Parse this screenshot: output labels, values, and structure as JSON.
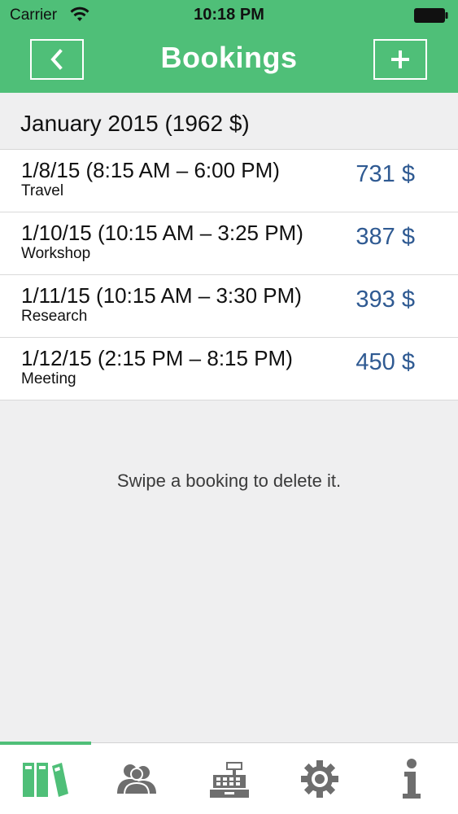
{
  "status_bar": {
    "carrier": "Carrier",
    "time": "10:18 PM"
  },
  "nav": {
    "title": "Bookings",
    "back_icon": "chevron-left-icon",
    "add_icon": "plus-icon"
  },
  "month_header": "January 2015 (1962 $)",
  "bookings": [
    {
      "when": "1/8/15  (8:15 AM – 6:00 PM)",
      "category": "Travel",
      "amount": "731 $"
    },
    {
      "when": "1/10/15  (10:15 AM – 3:25 PM)",
      "category": "Workshop",
      "amount": "387 $"
    },
    {
      "when": "1/11/15  (10:15 AM – 3:30 PM)",
      "category": "Research",
      "amount": "393 $"
    },
    {
      "when": "1/12/15  (2:15 PM – 8:15 PM)",
      "category": "Meeting",
      "amount": "450 $"
    }
  ],
  "hint": "Swipe a booking to delete it.",
  "tabs": [
    {
      "icon": "binders-icon",
      "active": true
    },
    {
      "icon": "people-icon",
      "active": false
    },
    {
      "icon": "cash-register-icon",
      "active": false
    },
    {
      "icon": "gear-icon",
      "active": false
    },
    {
      "icon": "info-icon",
      "active": false
    }
  ],
  "colors": {
    "accent": "#4fbf78",
    "amount": "#2f5a92",
    "icon_gray": "#6e6e6e"
  }
}
